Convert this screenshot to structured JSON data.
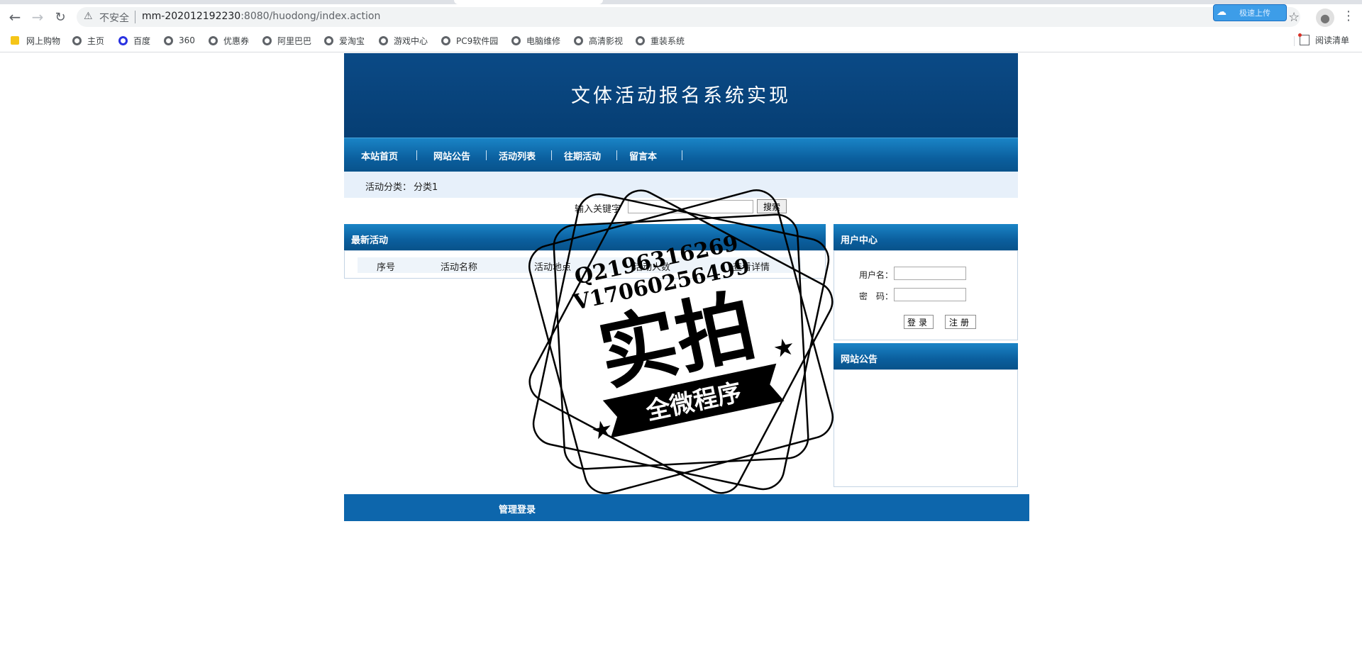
{
  "browser": {
    "insecure_label": "不安全",
    "url_host": "mm-202012192230",
    "url_rest": ":8080/huodong/index.action",
    "extension_badge": "极速上传",
    "reading_list": "阅读清单"
  },
  "bookmarks": [
    "网上购物",
    "主页",
    "百度",
    "360",
    "优惠券",
    "阿里巴巴",
    "爱淘宝",
    "游戏中心",
    "PC9软件园",
    "电脑维修",
    "高清影视",
    "重装系统"
  ],
  "site": {
    "title": "文体活动报名系统实现",
    "nav": [
      "本站首页",
      "网站公告",
      "活动列表",
      "往期活动",
      "留言本"
    ],
    "category_label": "活动分类：",
    "category_value": "分类1",
    "search_label": "输入关键字",
    "search_button": "搜索",
    "latest": {
      "title": "最新活动",
      "columns": [
        "序号",
        "活动名称",
        "活动地点",
        "活动人数",
        "查看详情"
      ]
    },
    "user_center": {
      "title": "用户中心",
      "username_label": "用户名：",
      "password_label": "密　码：",
      "login_button": "登录",
      "register_button": "注册"
    },
    "notice": {
      "title": "网站公告"
    },
    "footer_link": "管理登录"
  },
  "watermark": {
    "line1": "Q2196316269",
    "line2": "V17060256499",
    "main": "实拍",
    "ribbon": "全微程序"
  }
}
